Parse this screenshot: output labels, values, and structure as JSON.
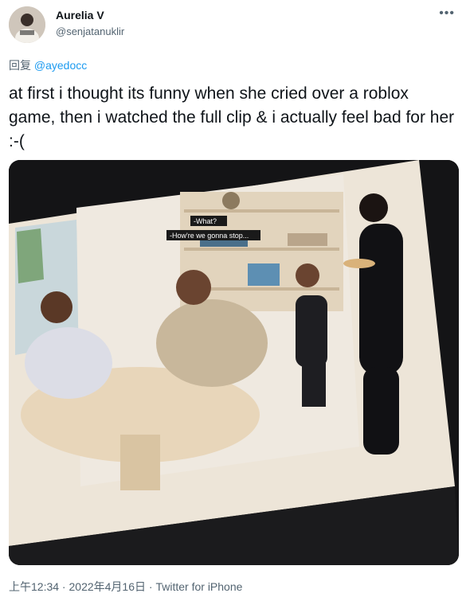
{
  "author": {
    "display_name": "Aurelia V",
    "handle": "@senjatanuklir"
  },
  "more_icon": "more-horizontal-icon",
  "reply": {
    "prefix": "回复",
    "mention": "@ayedocc"
  },
  "tweet": {
    "text": "at first i thought its funny when she cried over a roblox game, then i watched the full clip & i actually feel bad for her :-("
  },
  "media": {
    "subtitle_1": "-What?",
    "subtitle_2": "-How're we gonna stop..."
  },
  "meta": {
    "time": "上午12:34",
    "separator_1": " · ",
    "date": "2022年4月16日",
    "separator_2": " · ",
    "source": "Twitter for iPhone"
  },
  "colors": {
    "text": "#0f1419",
    "secondary": "#536471",
    "link": "#1d9bf0"
  }
}
